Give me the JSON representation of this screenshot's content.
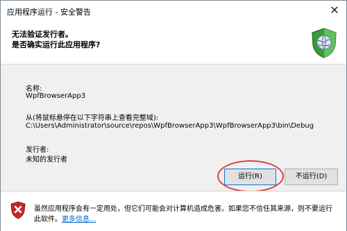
{
  "window": {
    "title": "应用程序运行 - 安全警告",
    "close_glyph": "✕"
  },
  "header": {
    "line1": "无法验证发行者。",
    "line2": "是否确实运行此应用程序?"
  },
  "details": {
    "name_label": "名称:",
    "name_value": "WpfBrowserApp3",
    "from_label": "从(将鼠标悬停在以下字符串上查看完整域):",
    "from_value": "C:\\Users\\Administrator\\source\\repos\\WpfBrowserApp3\\WpfBrowserApp3\\bin\\Debug",
    "publisher_label": "发行者:",
    "publisher_value": "未知的发行者"
  },
  "buttons": {
    "run_label": "运行(R)",
    "dont_run_label": "不运行(D)"
  },
  "footer": {
    "warning_line1": "虽然应用程序会有一定用处，但它们可能会对计算机造成危害。如果您不信任其来源，则不要运行",
    "warning_line2_prefix": "此软件。",
    "more_info_link": "更多信息..."
  },
  "icons": {
    "app_icon": "globe-shield-icon",
    "warning_icon": "red-shield-x-icon"
  },
  "colors": {
    "accent_border": "#0078d7",
    "highlight_circle": "#e03a3a",
    "link": "#0066cc",
    "panel_bg": "#f0f0f0"
  }
}
